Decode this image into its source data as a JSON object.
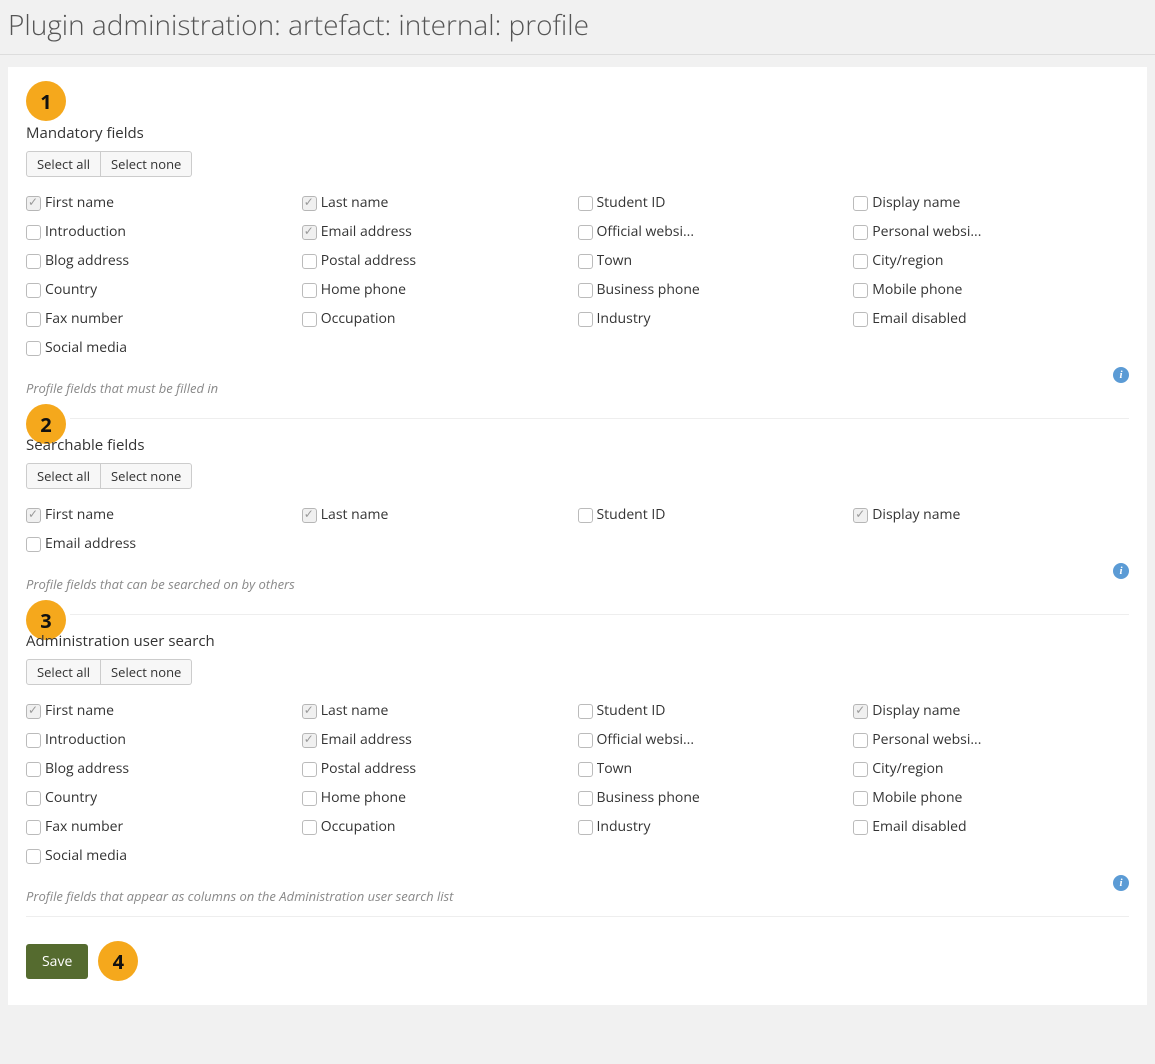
{
  "page": {
    "title": "Plugin administration: artefact: internal: profile"
  },
  "buttons": {
    "select_all": "Select all",
    "select_none": "Select none",
    "save": "Save"
  },
  "callouts": {
    "s1": "1",
    "s2": "2",
    "s3": "3",
    "s4": "4"
  },
  "sections": {
    "mandatory": {
      "legend": "Mandatory fields",
      "help": "Profile fields that must be filled in",
      "fields": [
        {
          "label": "First name",
          "checked": true
        },
        {
          "label": "Last name",
          "checked": true
        },
        {
          "label": "Student ID",
          "checked": false
        },
        {
          "label": "Display name",
          "checked": false
        },
        {
          "label": "Introduction",
          "checked": false
        },
        {
          "label": "Email address",
          "checked": true
        },
        {
          "label": "Official websi...",
          "checked": false
        },
        {
          "label": "Personal websi...",
          "checked": false
        },
        {
          "label": "Blog address",
          "checked": false
        },
        {
          "label": "Postal address",
          "checked": false
        },
        {
          "label": "Town",
          "checked": false
        },
        {
          "label": "City/region",
          "checked": false
        },
        {
          "label": "Country",
          "checked": false
        },
        {
          "label": "Home phone",
          "checked": false
        },
        {
          "label": "Business phone",
          "checked": false
        },
        {
          "label": "Mobile phone",
          "checked": false
        },
        {
          "label": "Fax number",
          "checked": false
        },
        {
          "label": "Occupation",
          "checked": false
        },
        {
          "label": "Industry",
          "checked": false
        },
        {
          "label": "Email disabled",
          "checked": false
        },
        {
          "label": "Social media",
          "checked": false
        }
      ]
    },
    "searchable": {
      "legend": "Searchable fields",
      "help": "Profile fields that can be searched on by others",
      "fields": [
        {
          "label": "First name",
          "checked": true
        },
        {
          "label": "Last name",
          "checked": true
        },
        {
          "label": "Student ID",
          "checked": false
        },
        {
          "label": "Display name",
          "checked": true
        },
        {
          "label": "Email address",
          "checked": false
        }
      ]
    },
    "adminsearch": {
      "legend": "Administration user search",
      "help": "Profile fields that appear as columns on the Administration user search list",
      "fields": [
        {
          "label": "First name",
          "checked": true
        },
        {
          "label": "Last name",
          "checked": true
        },
        {
          "label": "Student ID",
          "checked": false
        },
        {
          "label": "Display name",
          "checked": true
        },
        {
          "label": "Introduction",
          "checked": false
        },
        {
          "label": "Email address",
          "checked": true
        },
        {
          "label": "Official websi...",
          "checked": false
        },
        {
          "label": "Personal websi...",
          "checked": false
        },
        {
          "label": "Blog address",
          "checked": false
        },
        {
          "label": "Postal address",
          "checked": false
        },
        {
          "label": "Town",
          "checked": false
        },
        {
          "label": "City/region",
          "checked": false
        },
        {
          "label": "Country",
          "checked": false
        },
        {
          "label": "Home phone",
          "checked": false
        },
        {
          "label": "Business phone",
          "checked": false
        },
        {
          "label": "Mobile phone",
          "checked": false
        },
        {
          "label": "Fax number",
          "checked": false
        },
        {
          "label": "Occupation",
          "checked": false
        },
        {
          "label": "Industry",
          "checked": false
        },
        {
          "label": "Email disabled",
          "checked": false
        },
        {
          "label": "Social media",
          "checked": false
        }
      ]
    }
  }
}
